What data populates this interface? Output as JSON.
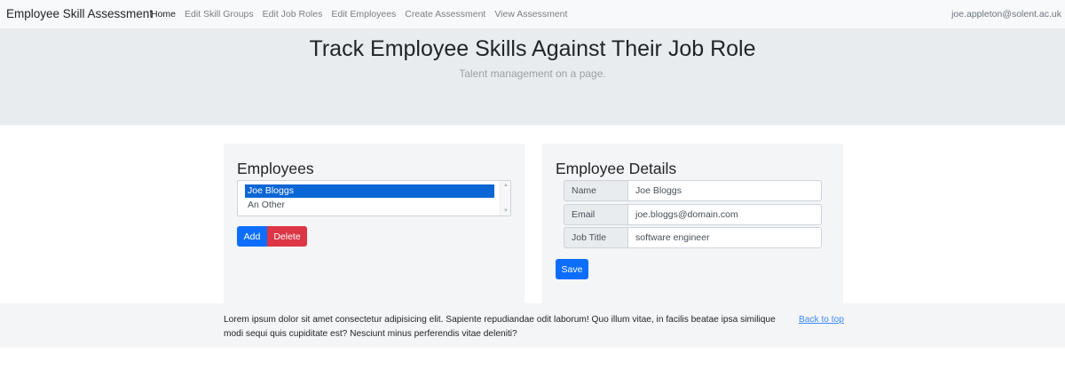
{
  "navbar": {
    "brand": "Employee Skill Assessment",
    "links": [
      "Home",
      "Edit Skill Groups",
      "Edit Job Roles",
      "Edit Employees",
      "Create Assessment",
      "View Assessment"
    ],
    "user": "joe.appleton@solent.ac.uk"
  },
  "hero": {
    "title": "Track Employee Skills Against Their Job Role",
    "subtitle": "Talent management on a page."
  },
  "employees": {
    "heading": "Employees",
    "items": [
      "Joe Bloggs",
      "An Other"
    ],
    "selected": "Joe Bloggs",
    "add_label": "Add",
    "delete_label": "Delete"
  },
  "details": {
    "heading": "Employee Details",
    "fields": [
      {
        "label": "Name",
        "value": "Joe Bloggs"
      },
      {
        "label": "Email",
        "value": "joe.bloggs@domain.com"
      },
      {
        "label": "Job Title",
        "value": "software engineer"
      }
    ],
    "save_label": "Save"
  },
  "footer": {
    "text": "Lorem ipsum dolor sit amet consectetur adipisicing elit. Sapiente repudiandae odit laborum! Quo illum vitae, in facilis beatae ipsa similique modi sequi quis cupiditate est? Nesciunt minus perferendis vitae deleniti?",
    "back_to_top": "Back to top"
  },
  "colors": {
    "primary": "#0d6efd",
    "danger": "#dc3545",
    "selection": "#0a66d4",
    "jumbotron": "#e9ecef"
  }
}
